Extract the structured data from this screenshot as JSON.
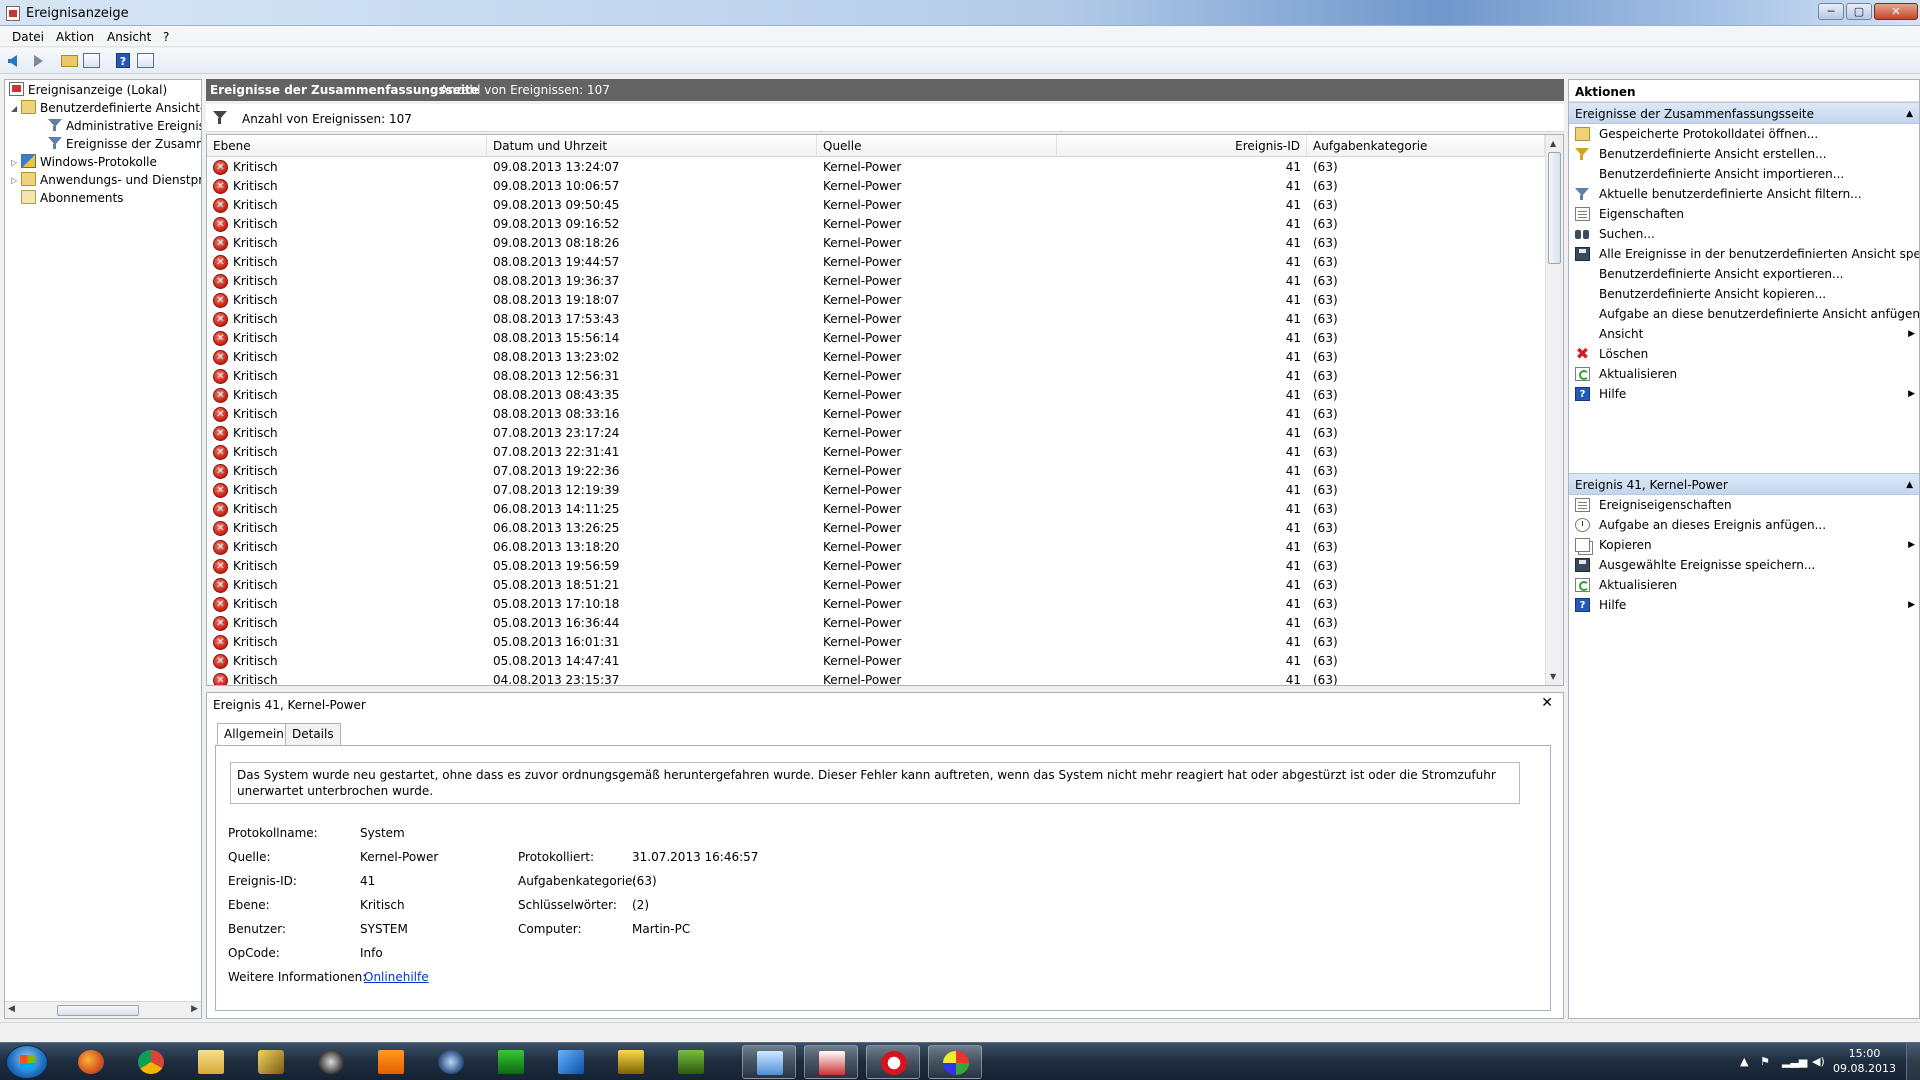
{
  "window": {
    "title": "Ereignisanzeige",
    "minimize": "─",
    "maximize": "▢",
    "close": "✕"
  },
  "menu": [
    "Datei",
    "Aktion",
    "Ansicht",
    "?"
  ],
  "toolbar": {
    "help": "?"
  },
  "tree": {
    "root": "Ereignisanzeige (Lokal)",
    "custom_views": "Benutzerdefinierte Ansichten",
    "admin_events": "Administrative Ereignisse",
    "summary_events": "Ereignisse der Zusammenfassungsseite",
    "windows_logs": "Windows-Protokolle",
    "app_service_logs": "Anwendungs- und Dienstprotokolle",
    "subscriptions": "Abonnements"
  },
  "center": {
    "header_title": "Ereignisse der Zusammenfassungsseite",
    "header_count": "Anzahl von Ereignissen: 107",
    "filter_text": "Anzahl von Ereignissen: 107",
    "columns": {
      "level": "Ebene",
      "datetime": "Datum und Uhrzeit",
      "source": "Quelle",
      "event_id": "Ereignis-ID",
      "task_category": "Aufgabenkategorie"
    },
    "rows": [
      {
        "level": "Kritisch",
        "datetime": "09.08.2013 13:24:07",
        "source": "Kernel-Power",
        "id": "41",
        "cat": "(63)"
      },
      {
        "level": "Kritisch",
        "datetime": "09.08.2013 10:06:57",
        "source": "Kernel-Power",
        "id": "41",
        "cat": "(63)"
      },
      {
        "level": "Kritisch",
        "datetime": "09.08.2013 09:50:45",
        "source": "Kernel-Power",
        "id": "41",
        "cat": "(63)"
      },
      {
        "level": "Kritisch",
        "datetime": "09.08.2013 09:16:52",
        "source": "Kernel-Power",
        "id": "41",
        "cat": "(63)"
      },
      {
        "level": "Kritisch",
        "datetime": "09.08.2013 08:18:26",
        "source": "Kernel-Power",
        "id": "41",
        "cat": "(63)"
      },
      {
        "level": "Kritisch",
        "datetime": "08.08.2013 19:44:57",
        "source": "Kernel-Power",
        "id": "41",
        "cat": "(63)"
      },
      {
        "level": "Kritisch",
        "datetime": "08.08.2013 19:36:37",
        "source": "Kernel-Power",
        "id": "41",
        "cat": "(63)"
      },
      {
        "level": "Kritisch",
        "datetime": "08.08.2013 19:18:07",
        "source": "Kernel-Power",
        "id": "41",
        "cat": "(63)"
      },
      {
        "level": "Kritisch",
        "datetime": "08.08.2013 17:53:43",
        "source": "Kernel-Power",
        "id": "41",
        "cat": "(63)"
      },
      {
        "level": "Kritisch",
        "datetime": "08.08.2013 15:56:14",
        "source": "Kernel-Power",
        "id": "41",
        "cat": "(63)"
      },
      {
        "level": "Kritisch",
        "datetime": "08.08.2013 13:23:02",
        "source": "Kernel-Power",
        "id": "41",
        "cat": "(63)"
      },
      {
        "level": "Kritisch",
        "datetime": "08.08.2013 12:56:31",
        "source": "Kernel-Power",
        "id": "41",
        "cat": "(63)"
      },
      {
        "level": "Kritisch",
        "datetime": "08.08.2013 08:43:35",
        "source": "Kernel-Power",
        "id": "41",
        "cat": "(63)"
      },
      {
        "level": "Kritisch",
        "datetime": "08.08.2013 08:33:16",
        "source": "Kernel-Power",
        "id": "41",
        "cat": "(63)"
      },
      {
        "level": "Kritisch",
        "datetime": "07.08.2013 23:17:24",
        "source": "Kernel-Power",
        "id": "41",
        "cat": "(63)"
      },
      {
        "level": "Kritisch",
        "datetime": "07.08.2013 22:31:41",
        "source": "Kernel-Power",
        "id": "41",
        "cat": "(63)"
      },
      {
        "level": "Kritisch",
        "datetime": "07.08.2013 19:22:36",
        "source": "Kernel-Power",
        "id": "41",
        "cat": "(63)"
      },
      {
        "level": "Kritisch",
        "datetime": "07.08.2013 12:19:39",
        "source": "Kernel-Power",
        "id": "41",
        "cat": "(63)"
      },
      {
        "level": "Kritisch",
        "datetime": "06.08.2013 14:11:25",
        "source": "Kernel-Power",
        "id": "41",
        "cat": "(63)"
      },
      {
        "level": "Kritisch",
        "datetime": "06.08.2013 13:26:25",
        "source": "Kernel-Power",
        "id": "41",
        "cat": "(63)"
      },
      {
        "level": "Kritisch",
        "datetime": "06.08.2013 13:18:20",
        "source": "Kernel-Power",
        "id": "41",
        "cat": "(63)"
      },
      {
        "level": "Kritisch",
        "datetime": "05.08.2013 19:56:59",
        "source": "Kernel-Power",
        "id": "41",
        "cat": "(63)"
      },
      {
        "level": "Kritisch",
        "datetime": "05.08.2013 18:51:21",
        "source": "Kernel-Power",
        "id": "41",
        "cat": "(63)"
      },
      {
        "level": "Kritisch",
        "datetime": "05.08.2013 17:10:18",
        "source": "Kernel-Power",
        "id": "41",
        "cat": "(63)"
      },
      {
        "level": "Kritisch",
        "datetime": "05.08.2013 16:36:44",
        "source": "Kernel-Power",
        "id": "41",
        "cat": "(63)"
      },
      {
        "level": "Kritisch",
        "datetime": "05.08.2013 16:01:31",
        "source": "Kernel-Power",
        "id": "41",
        "cat": "(63)"
      },
      {
        "level": "Kritisch",
        "datetime": "05.08.2013 14:47:41",
        "source": "Kernel-Power",
        "id": "41",
        "cat": "(63)"
      },
      {
        "level": "Kritisch",
        "datetime": "04.08.2013 23:15:37",
        "source": "Kernel-Power",
        "id": "41",
        "cat": "(63)"
      }
    ]
  },
  "detail": {
    "title": "Ereignis 41, Kernel-Power",
    "close": "✕",
    "tabs": {
      "general": "Allgemein",
      "details": "Details"
    },
    "description": "Das System wurde neu gestartet, ohne dass es zuvor ordnungsgemäß heruntergefahren wurde. Dieser Fehler kann auftreten, wenn das System nicht mehr reagiert hat oder abgestürzt ist oder die Stromzufuhr unerwartet unterbrochen wurde.",
    "fields": {
      "log_name_label": "Protokollname:",
      "log_name": "System",
      "source_label": "Quelle:",
      "source": "Kernel-Power",
      "logged_label": "Protokolliert:",
      "logged": "31.07.2013 16:46:57",
      "event_id_label": "Ereignis-ID:",
      "event_id": "41",
      "task_cat_label": "Aufgabenkategorie:",
      "task_cat": "(63)",
      "level_label": "Ebene:",
      "level": "Kritisch",
      "keywords_label": "Schlüsselwörter:",
      "keywords": "(2)",
      "user_label": "Benutzer:",
      "user": "SYSTEM",
      "computer_label": "Computer:",
      "computer": "Martin-PC",
      "opcode_label": "OpCode:",
      "opcode": "Info",
      "more_info_label": "Weitere Informationen:",
      "more_info_link": "Onlinehilfe"
    }
  },
  "actions": {
    "title": "Aktionen",
    "section1": {
      "title": "Ereignisse der Zusammenfassungsseite",
      "items": [
        "Gespeicherte Protokolldatei öffnen...",
        "Benutzerdefinierte Ansicht erstellen...",
        "Benutzerdefinierte Ansicht importieren...",
        "Aktuelle benutzerdefinierte Ansicht filtern...",
        "Eigenschaften",
        "Suchen...",
        "Alle Ereignisse in der benutzerdefinierten Ansicht speic...",
        "Benutzerdefinierte Ansicht exportieren...",
        "Benutzerdefinierte Ansicht kopieren...",
        "Aufgabe an diese benutzerdefinierte Ansicht anfügen...",
        "Ansicht",
        "Löschen",
        "Aktualisieren",
        "Hilfe"
      ]
    },
    "section2": {
      "title": "Ereignis 41, Kernel-Power",
      "items": [
        "Ereigniseigenschaften",
        "Aufgabe an dieses Ereignis anfügen...",
        "Kopieren",
        "Ausgewählte Ereignisse speichern...",
        "Aktualisieren",
        "Hilfe"
      ]
    }
  },
  "taskbar": {
    "time": "15:00",
    "date": "09.08.2013"
  }
}
